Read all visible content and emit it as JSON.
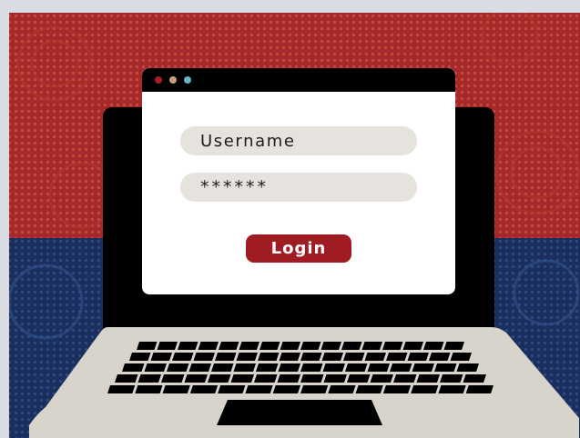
{
  "login_form": {
    "username_placeholder": "Username",
    "password_mask": "******",
    "login_label": "Login"
  },
  "colors": {
    "background_red": "#a82a26",
    "background_blue": "#1d3465",
    "button": "#9e1c22",
    "field": "#e6e2dd",
    "laptop_base": "#d8d3cb"
  },
  "icons": [
    "window-close-dot",
    "window-minimize-dot",
    "window-maximize-dot",
    "laptop-keyboard",
    "trackpad"
  ]
}
